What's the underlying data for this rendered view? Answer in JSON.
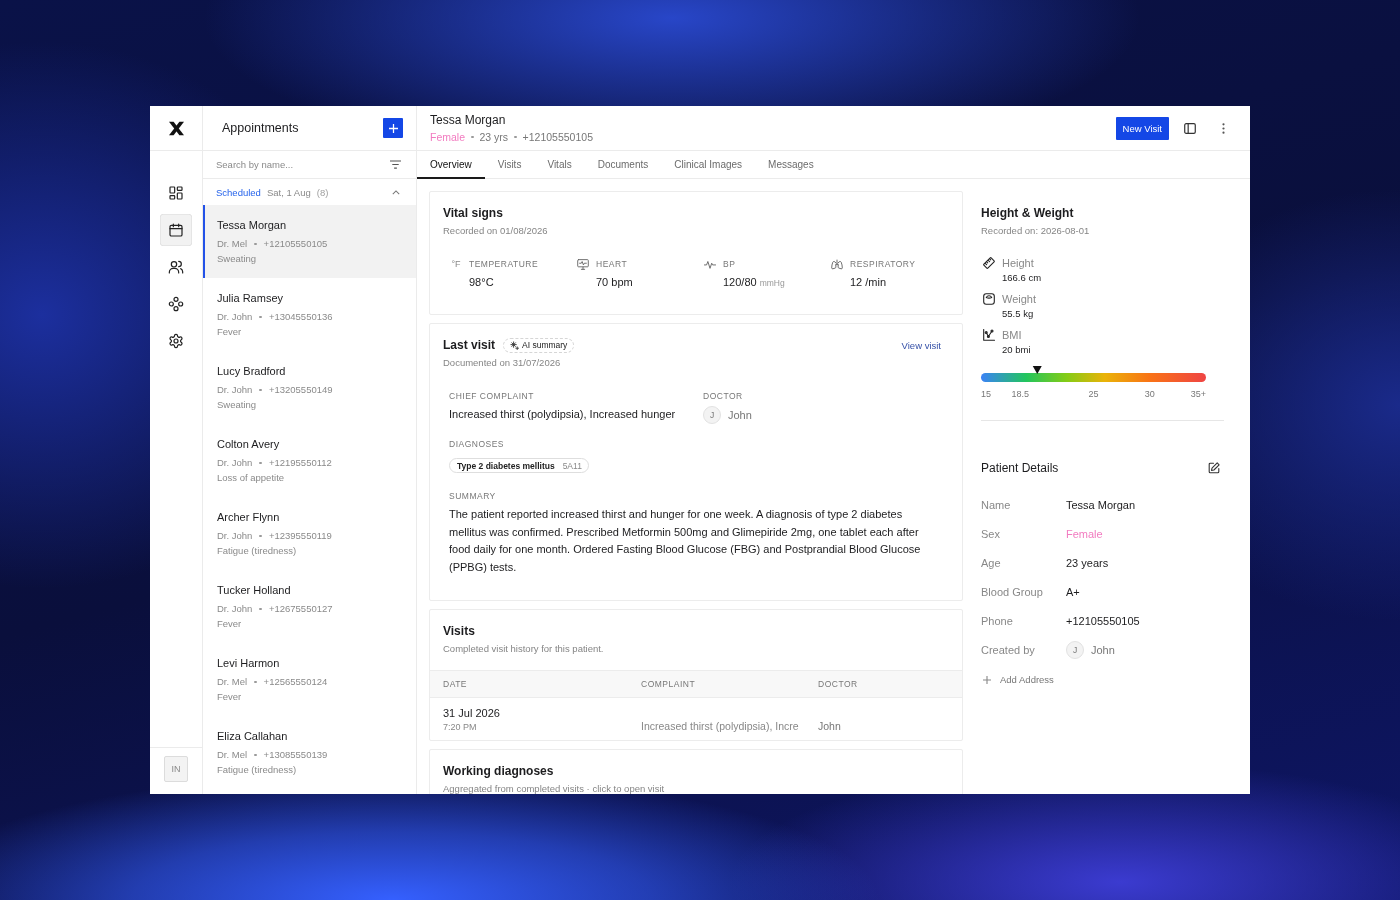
{
  "rail": {
    "items": [
      {
        "kind": "dashboard",
        "selected": false
      },
      {
        "kind": "calendar",
        "selected": true
      },
      {
        "kind": "patients",
        "selected": false
      },
      {
        "kind": "integrations",
        "selected": false
      },
      {
        "kind": "settings",
        "selected": false
      }
    ],
    "user_initials": "IN"
  },
  "appointments": {
    "title": "Appointments",
    "search": {
      "placeholder": "Search by name..."
    },
    "group": {
      "status": "Scheduled",
      "date": "Sat, 1 Aug",
      "count": "(8)",
      "expanded": true
    },
    "items": [
      {
        "name": "Tessa Morgan",
        "doctor": "Dr. Mel",
        "phone": "+12105550105",
        "complaint": "Sweating",
        "selected": true
      },
      {
        "name": "Julia Ramsey",
        "doctor": "Dr. John",
        "phone": "+13045550136",
        "complaint": "Fever",
        "selected": false
      },
      {
        "name": "Lucy Bradford",
        "doctor": "Dr. John",
        "phone": "+13205550149",
        "complaint": "Sweating",
        "selected": false
      },
      {
        "name": "Colton Avery",
        "doctor": "Dr. John",
        "phone": "+12195550112",
        "complaint": "Loss of appetite",
        "selected": false
      },
      {
        "name": "Archer Flynn",
        "doctor": "Dr. John",
        "phone": "+12395550119",
        "complaint": "Fatigue (tiredness)",
        "selected": false
      },
      {
        "name": "Tucker Holland",
        "doctor": "Dr. John",
        "phone": "+12675550127",
        "complaint": "Fever",
        "selected": false
      },
      {
        "name": "Levi Harmon",
        "doctor": "Dr. Mel",
        "phone": "+12565550124",
        "complaint": "Fever",
        "selected": false
      },
      {
        "name": "Eliza Callahan",
        "doctor": "Dr. Mel",
        "phone": "+13085550139",
        "complaint": "Fatigue (tiredness)",
        "selected": false
      }
    ]
  },
  "patient": {
    "name": "Tessa Morgan",
    "sex": "Female",
    "age": "23 yrs",
    "phone": "+12105550105"
  },
  "header_actions": {
    "new_visit": "New Visit"
  },
  "tabs": [
    {
      "label": "Overview",
      "selected": true
    },
    {
      "label": "Visits",
      "selected": false
    },
    {
      "label": "Vitals",
      "selected": false
    },
    {
      "label": "Documents",
      "selected": false
    },
    {
      "label": "Clinical Images",
      "selected": false
    },
    {
      "label": "Messages",
      "selected": false
    }
  ],
  "vital_signs": {
    "title": "Vital signs",
    "recorded": "Recorded on 01/08/2026",
    "items": [
      {
        "kind": "temperature",
        "icon_text": "°F",
        "label": "TEMPERATURE",
        "value": "98°C"
      },
      {
        "kind": "heart",
        "label": "HEART",
        "value": "70 bpm"
      },
      {
        "kind": "bp",
        "label": "BP",
        "value": "120/80",
        "unit": "mmHg"
      },
      {
        "kind": "respiratory",
        "label": "RESPIRATORY",
        "value": "12 /min"
      }
    ]
  },
  "last_visit": {
    "title": "Last visit",
    "ai_badge": "AI summary",
    "link": "View visit",
    "documented": "Documented on 31/07/2026",
    "chief_complaint": {
      "label": "CHIEF COMPLAINT",
      "value": "Increased thirst (polydipsia), Increased hunger"
    },
    "doctor": {
      "label": "DOCTOR",
      "initial": "J",
      "name": "John"
    },
    "diagnoses": {
      "label": "DIAGNOSES",
      "items": [
        {
          "name": "Type 2 diabetes mellitus",
          "code": "5A11"
        }
      ]
    },
    "summary": {
      "label": "SUMMARY",
      "text": "The patient reported increased thirst and hunger for one week. A diagnosis of type 2 diabetes mellitus was confirmed. Prescribed Metformin 500mg and Glimepiride 2mg, one tablet each after food daily for one month. Ordered Fasting Blood Glucose (FBG) and Postprandial Blood Glucose (PPBG) tests."
    }
  },
  "visits": {
    "title": "Visits",
    "subtitle": "Completed visit history for this patient.",
    "columns": [
      "DATE",
      "COMPLAINT",
      "DOCTOR"
    ],
    "rows": [
      {
        "date": "31 Jul 2026",
        "time": "7:20 PM",
        "complaint": "Increased thirst (polydipsia), Incre",
        "doctor": "John"
      }
    ]
  },
  "working_diagnoses": {
    "title": "Working diagnoses",
    "subtitle": "Aggregated from completed visits · click to open visit"
  },
  "height_weight": {
    "title": "Height & Weight",
    "recorded": "Recorded on: 2026-08-01",
    "measures": [
      {
        "kind": "height",
        "label": "Height",
        "value": "166.6 cm"
      },
      {
        "kind": "weight",
        "label": "Weight",
        "value": "55.5 kg"
      },
      {
        "kind": "bmi",
        "label": "BMI",
        "value": "20 bmi"
      }
    ],
    "bmi_scale": {
      "level": 0.25,
      "ticks": [
        "15",
        "18.5",
        "25",
        "30",
        "35+"
      ]
    }
  },
  "patient_details": {
    "title": "Patient Details",
    "rows": [
      {
        "kind": "text",
        "label": "Name",
        "value": "Tessa Morgan"
      },
      {
        "kind": "sex",
        "label": "Sex",
        "value": "Female"
      },
      {
        "kind": "text",
        "label": "Age",
        "value": "23 years"
      },
      {
        "kind": "text",
        "label": "Blood Group",
        "value": "A+"
      },
      {
        "kind": "text",
        "label": "Phone",
        "value": "+12105550105"
      },
      {
        "kind": "person",
        "label": "Created by",
        "initial": "J",
        "value": "John"
      }
    ],
    "add_address": "Add Address"
  }
}
